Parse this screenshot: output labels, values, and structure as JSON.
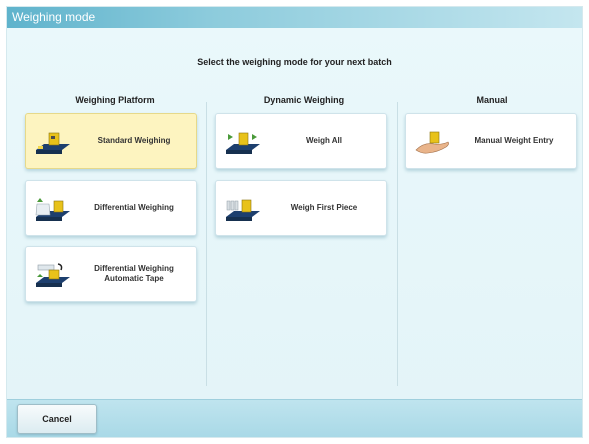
{
  "window": {
    "title": "Weighing mode"
  },
  "prompt": "Select the weighing mode for your next batch",
  "columns": {
    "platform": {
      "header": "Weighing Platform",
      "items": [
        {
          "label": "Standard Weighing",
          "icon": "scale-platform-icon",
          "selected": true
        },
        {
          "label": "Differential Weighing",
          "icon": "stack-on-scale-icon",
          "selected": false
        },
        {
          "label": "Differential Weighing\nAutomatic Tape",
          "icon": "tape-dispenser-scale-icon",
          "selected": false
        }
      ]
    },
    "dynamic": {
      "header": "Dynamic Weighing",
      "items": [
        {
          "label": "Weigh All",
          "icon": "conveyor-weigh-all-icon",
          "selected": false
        },
        {
          "label": "Weigh First Piece",
          "icon": "conveyor-first-piece-icon",
          "selected": false
        }
      ]
    },
    "manual": {
      "header": "Manual",
      "items": [
        {
          "label": "Manual Weight Entry",
          "icon": "hand-weight-icon",
          "selected": false
        }
      ]
    }
  },
  "footer": {
    "cancel_label": "Cancel"
  },
  "colors": {
    "selected_tile": "#fdf4c0",
    "accent_yellow": "#e8c21a",
    "accent_blue": "#1d3f6e",
    "titlebar": "#5fb3cc"
  }
}
